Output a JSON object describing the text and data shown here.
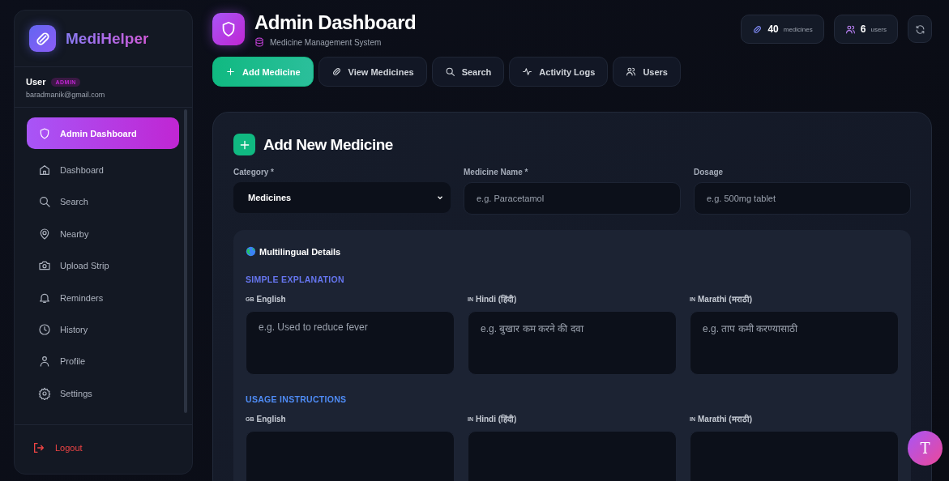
{
  "brand": {
    "name": "MediHelper"
  },
  "user": {
    "name": "User",
    "role": "ADMIN",
    "email": "baradmanik@gmail.com"
  },
  "sidebar": {
    "items": [
      {
        "label": "Admin Dashboard",
        "selected": true
      },
      {
        "label": "Dashboard",
        "selected": false
      },
      {
        "label": "Search",
        "selected": false
      },
      {
        "label": "Nearby",
        "selected": false
      },
      {
        "label": "Upload Strip",
        "selected": false
      },
      {
        "label": "Reminders",
        "selected": false
      },
      {
        "label": "History",
        "selected": false
      },
      {
        "label": "Profile",
        "selected": false
      },
      {
        "label": "Settings",
        "selected": false
      }
    ],
    "logout": "Logout"
  },
  "header": {
    "title": "Admin Dashboard",
    "subtitle": "Medicine Management System"
  },
  "stats": [
    {
      "value": "40",
      "unit": "medicines"
    },
    {
      "value": "6",
      "unit": "users"
    }
  ],
  "tabs": [
    {
      "label": "Add Medicine",
      "selected": true
    },
    {
      "label": "View Medicines",
      "selected": false
    },
    {
      "label": "Search",
      "selected": false
    },
    {
      "label": "Activity Logs",
      "selected": false
    },
    {
      "label": "Users",
      "selected": false
    }
  ],
  "form": {
    "title": "Add New Medicine",
    "fields": [
      {
        "kind": "select",
        "label": "Category *",
        "value": "Medicines"
      },
      {
        "kind": "input",
        "label": "Medicine Name *",
        "placeholder": "e.g. Paracetamol"
      },
      {
        "kind": "input",
        "label": "Dosage",
        "placeholder": "e.g. 500mg tablet"
      }
    ],
    "multilingual": {
      "title": "Multilingual Details",
      "sections": [
        {
          "heading": "SIMPLE EXPLANATION",
          "fields": [
            {
              "flag": "GB",
              "language": "English",
              "placeholder": "e.g. Used to reduce fever"
            },
            {
              "flag": "IN",
              "language": "Hindi (हिंदी)",
              "placeholder": "e.g. बुखार कम करने की दवा"
            },
            {
              "flag": "IN",
              "language": "Marathi (मराठी)",
              "placeholder": "e.g. ताप कमी करण्यासाठी"
            }
          ]
        },
        {
          "heading": "USAGE INSTRUCTIONS",
          "fields": [
            {
              "flag": "GB",
              "language": "English"
            },
            {
              "flag": "IN",
              "language": "Hindi (हिंदी)"
            },
            {
              "flag": "IN",
              "language": "Marathi (मराठी)"
            }
          ]
        }
      ]
    }
  },
  "fab": {
    "label": "T"
  }
}
